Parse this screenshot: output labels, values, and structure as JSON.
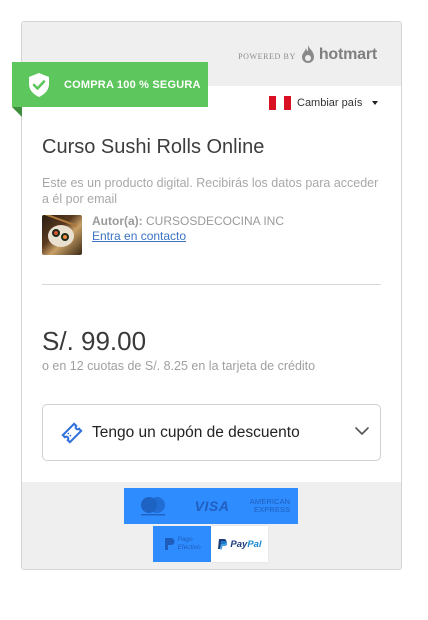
{
  "header": {
    "powered_by": "POWERED BY",
    "brand": "hotmart"
  },
  "badge": {
    "label": "COMPRA 100 % SEGURA",
    "color": "#5dc65c"
  },
  "country_selector": {
    "label": "Cambiar país",
    "flag": [
      "#d91023",
      "#ffffff",
      "#d91023"
    ]
  },
  "product": {
    "title": "Curso Sushi Rolls Online",
    "description": "Este es un producto digital. Recibirás los datos para acceder a él por email",
    "author_key": "Autor(a):",
    "author_name": "CURSOSDECOCINA INC",
    "contact_link": "Entra en contacto"
  },
  "pricing": {
    "price": "S/. 99.00",
    "installments": "o en 12 cuotas de S/. 8.25 en la tarjeta de crédito"
  },
  "coupon": {
    "label": "Tengo un cupón de descuento",
    "icon": "ticket-icon"
  },
  "payment_methods": {
    "visa": "VISA",
    "amex_line1": "AMERICAN",
    "amex_line2": "EXPRESS",
    "pagoefectivo_line1": "Pago",
    "pagoefectivo_line2": "Efectivo",
    "paypal_pay": "Pay",
    "paypal_pal": "Pal"
  },
  "colors": {
    "accent_green": "#5dc65c",
    "link_blue": "#3b74c2",
    "payment_highlight": "#2f8cff"
  }
}
